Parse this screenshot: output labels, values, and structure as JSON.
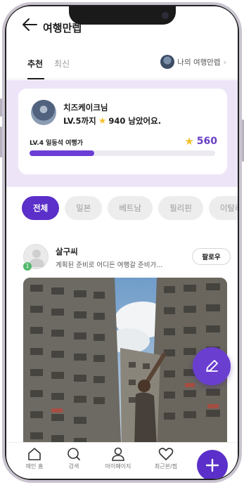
{
  "header": {
    "title": "여행만렙"
  },
  "tabs": {
    "active": "추천",
    "inactive": "최신",
    "my_guide": "나의 여행만렙",
    "chevron": "›"
  },
  "level_card": {
    "user_name": "치즈케이크님",
    "message_prefix": "LV.5까지",
    "message_suffix": "940 남았어요.",
    "star": "★",
    "current_level": "LV.4 일등석 여행가",
    "points": "560",
    "progress_fraction": 0.35
  },
  "chips": [
    "전체",
    "일본",
    "베트남",
    "필리핀",
    "이탈리아"
  ],
  "post": {
    "user_name": "살구씨",
    "description": "계획된 준비로 어디든 여행갈 준비가...",
    "badge": "1",
    "follow_label": "팔로우"
  },
  "bottom_nav": {
    "items": [
      {
        "label": "메인 홈",
        "icon": "home-icon"
      },
      {
        "label": "검색",
        "icon": "search-icon"
      },
      {
        "label": "마이페이지",
        "icon": "person-icon"
      },
      {
        "label": "최근본/찜",
        "icon": "heart-icon"
      }
    ]
  },
  "colors": {
    "accent": "#5b2fc9",
    "card_bg": "#ede5f7",
    "star": "#f2c12e"
  }
}
